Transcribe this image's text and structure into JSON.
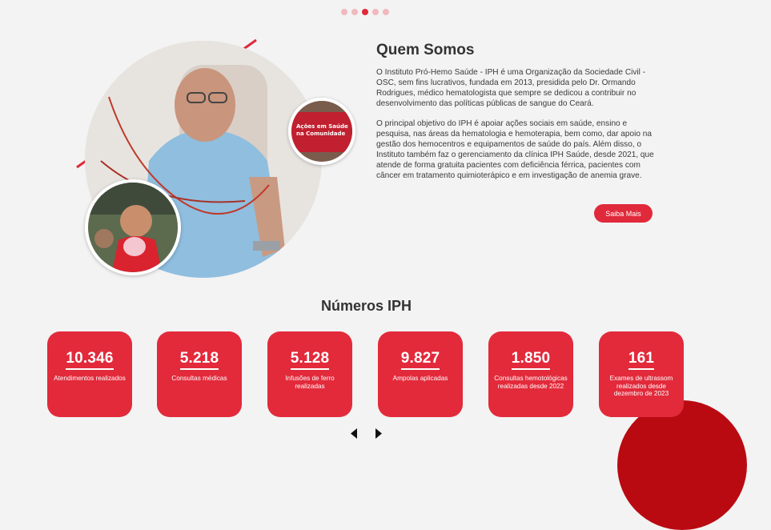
{
  "carousel": {
    "dots": 5,
    "active_index": 2
  },
  "hero": {
    "main_photo": "elderly-man-donating-blood-photo",
    "top_photo_text": "Ações em Saúde na Comunidade",
    "bottom_photo": "child-eating-cotton-candy-photo"
  },
  "about": {
    "title": "Quem Somos",
    "paragraph1": "O Instituto Pró-Hemo Saúde - IPH é uma Organização da Sociedade Civil - OSC, sem fins lucrativos, fundada em 2013, presidida pelo Dr. Ormando Rodrigues, médico hematologista que sempre se dedicou a contribuir no desenvolvimento das políticas públicas de sangue do Ceará.",
    "paragraph2": "O principal objetivo do IPH é apoiar ações sociais em saúde, ensino e pesquisa, nas áreas da hematologia e hemoterapia, bem como, dar apoio na gestão dos hemocentros e equipamentos de saúde do país. Além disso, o Instituto também faz o gerenciamento da clínica IPH Saúde, desde 2021, que atende de forma gratuita pacientes com deficiência férrica, pacientes com câncer em tratamento quimioterápico e em investigação de anemia grave.",
    "button_label": "Saiba Mais"
  },
  "numbers": {
    "title": "Números IPH",
    "cards": [
      {
        "value": "10.346",
        "label": "Atendimentos realizados"
      },
      {
        "value": "5.218",
        "label": "Consultas médicas"
      },
      {
        "value": "5.128",
        "label": "Infusões de ferro realizadas"
      },
      {
        "value": "9.827",
        "label": "Ampolas aplicadas"
      },
      {
        "value": "1.850",
        "label": "Consultas hemotológicas realizadas desde 2022"
      },
      {
        "value": "161",
        "label": "Exames de ultrassom realizados desde dezembro de 2023"
      }
    ]
  },
  "nav": {
    "prev_icon": "arrow-left-icon",
    "next_icon": "arrow-right-icon"
  },
  "colors": {
    "brand_red": "#e22a3b",
    "dark_red": "#b90a12",
    "dot_inactive": "#f0b9bd",
    "background": "#f3f3f3"
  }
}
